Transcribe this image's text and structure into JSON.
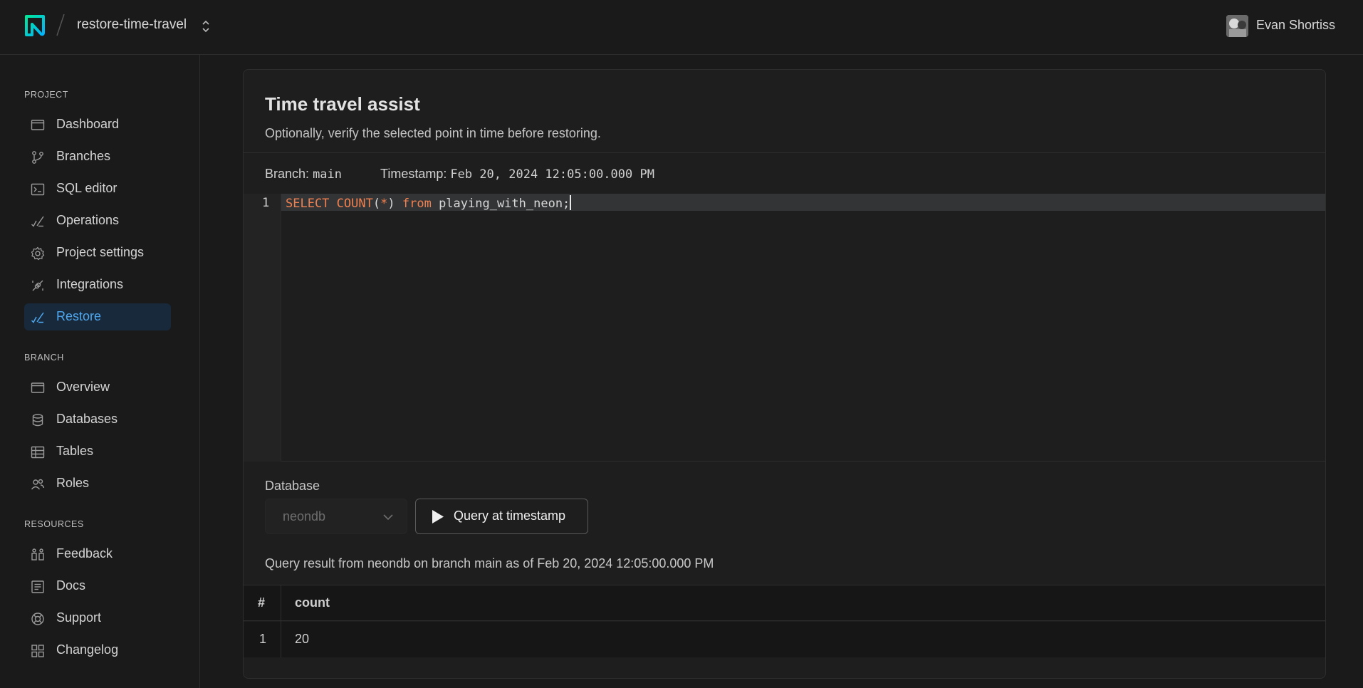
{
  "header": {
    "project_name": "restore-time-travel",
    "user_name": "Evan Shortiss"
  },
  "sidebar": {
    "sections": [
      {
        "label": "PROJECT",
        "items": [
          {
            "label": "Dashboard",
            "icon": "dashboard-icon"
          },
          {
            "label": "Branches",
            "icon": "branches-icon"
          },
          {
            "label": "SQL editor",
            "icon": "sql-editor-icon"
          },
          {
            "label": "Operations",
            "icon": "operations-icon"
          },
          {
            "label": "Project settings",
            "icon": "gear-icon"
          },
          {
            "label": "Integrations",
            "icon": "integrations-icon"
          },
          {
            "label": "Restore",
            "icon": "restore-icon",
            "active": true
          }
        ]
      },
      {
        "label": "BRANCH",
        "items": [
          {
            "label": "Overview",
            "icon": "overview-icon"
          },
          {
            "label": "Databases",
            "icon": "database-icon"
          },
          {
            "label": "Tables",
            "icon": "table-icon"
          },
          {
            "label": "Roles",
            "icon": "roles-icon"
          }
        ]
      },
      {
        "label": "RESOURCES",
        "items": [
          {
            "label": "Feedback",
            "icon": "feedback-icon"
          },
          {
            "label": "Docs",
            "icon": "docs-icon"
          },
          {
            "label": "Support",
            "icon": "support-icon"
          },
          {
            "label": "Changelog",
            "icon": "changelog-icon"
          }
        ]
      }
    ]
  },
  "main": {
    "title": "Time travel assist",
    "subtitle": "Optionally, verify the selected point in time before restoring.",
    "branch_label": "Branch:",
    "branch_value": "main",
    "timestamp_label": "Timestamp:",
    "timestamp_value": "Feb 20, 2024 12:05:00.000 PM",
    "editor": {
      "line_number": "1",
      "tokens": {
        "select": "SELECT",
        "count": "COUNT",
        "paren_open": "(",
        "star": "*",
        "paren_close": ")",
        "from": "from",
        "table": "playing_with_neon;"
      }
    },
    "database_label": "Database",
    "database_value": "neondb",
    "query_button_label": "Query at timestamp",
    "result_caption": "Query result from neondb on branch main as of Feb 20, 2024 12:05:00.000 PM",
    "results": {
      "columns": [
        "#",
        "count"
      ],
      "rows": [
        [
          "1",
          "20"
        ]
      ]
    }
  },
  "colors": {
    "accent": "#4fa8f0",
    "brand": "#35e2a0",
    "keyword": "#f08050"
  }
}
